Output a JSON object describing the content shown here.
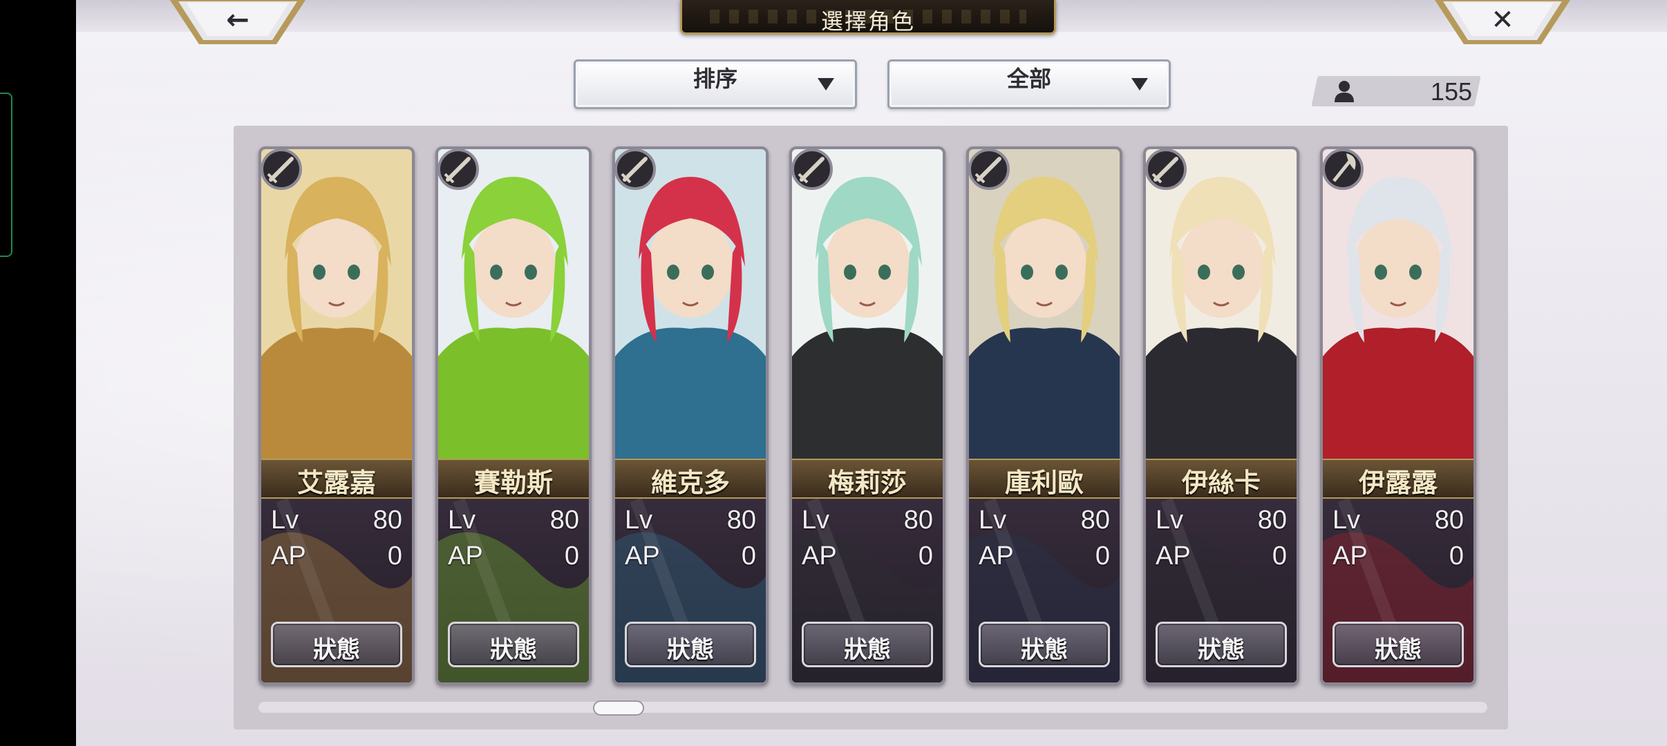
{
  "header": {
    "title": "選擇角色",
    "back_icon": "←",
    "close_icon": "✕"
  },
  "filters": {
    "sort_label": "排序",
    "filter_label": "全部"
  },
  "character_count": "155",
  "stat_labels": {
    "level": "Lv",
    "ap": "AP"
  },
  "status_button_label": "狀態",
  "characters": [
    {
      "name": "艾露嘉",
      "lv": "80",
      "ap": "0",
      "weapon": "sword-icon",
      "palette": "#e9d8a6",
      "accent": "#b98a3c",
      "hair": "#d8b25c"
    },
    {
      "name": "賽勒斯",
      "lv": "80",
      "ap": "0",
      "weapon": "sword-icon",
      "palette": "#e8eef2",
      "accent": "#7bbf2a",
      "hair": "#8ad13a"
    },
    {
      "name": "維克多",
      "lv": "80",
      "ap": "0",
      "weapon": "sword-icon",
      "palette": "#cfe2e8",
      "accent": "#2f6f8f",
      "hair": "#d4324a"
    },
    {
      "name": "梅莉莎",
      "lv": "80",
      "ap": "0",
      "weapon": "sword-icon",
      "palette": "#eef3f1",
      "accent": "#2c2e30",
      "hair": "#9fd8c4"
    },
    {
      "name": "庫利歐",
      "lv": "80",
      "ap": "0",
      "weapon": "sword-icon",
      "palette": "#d9d2bf",
      "accent": "#27364f",
      "hair": "#e3cf7e"
    },
    {
      "name": "伊絲卡",
      "lv": "80",
      "ap": "0",
      "weapon": "sword-icon",
      "palette": "#f1ece1",
      "accent": "#2b2a30",
      "hair": "#efe0b8"
    },
    {
      "name": "伊露露",
      "lv": "80",
      "ap": "0",
      "weapon": "axe-icon",
      "palette": "#f0e2e2",
      "accent": "#b01f2a",
      "hair": "#dfe3ea"
    }
  ],
  "colors": {
    "gold": "#b59a5b",
    "name_band": "#4a3826"
  }
}
